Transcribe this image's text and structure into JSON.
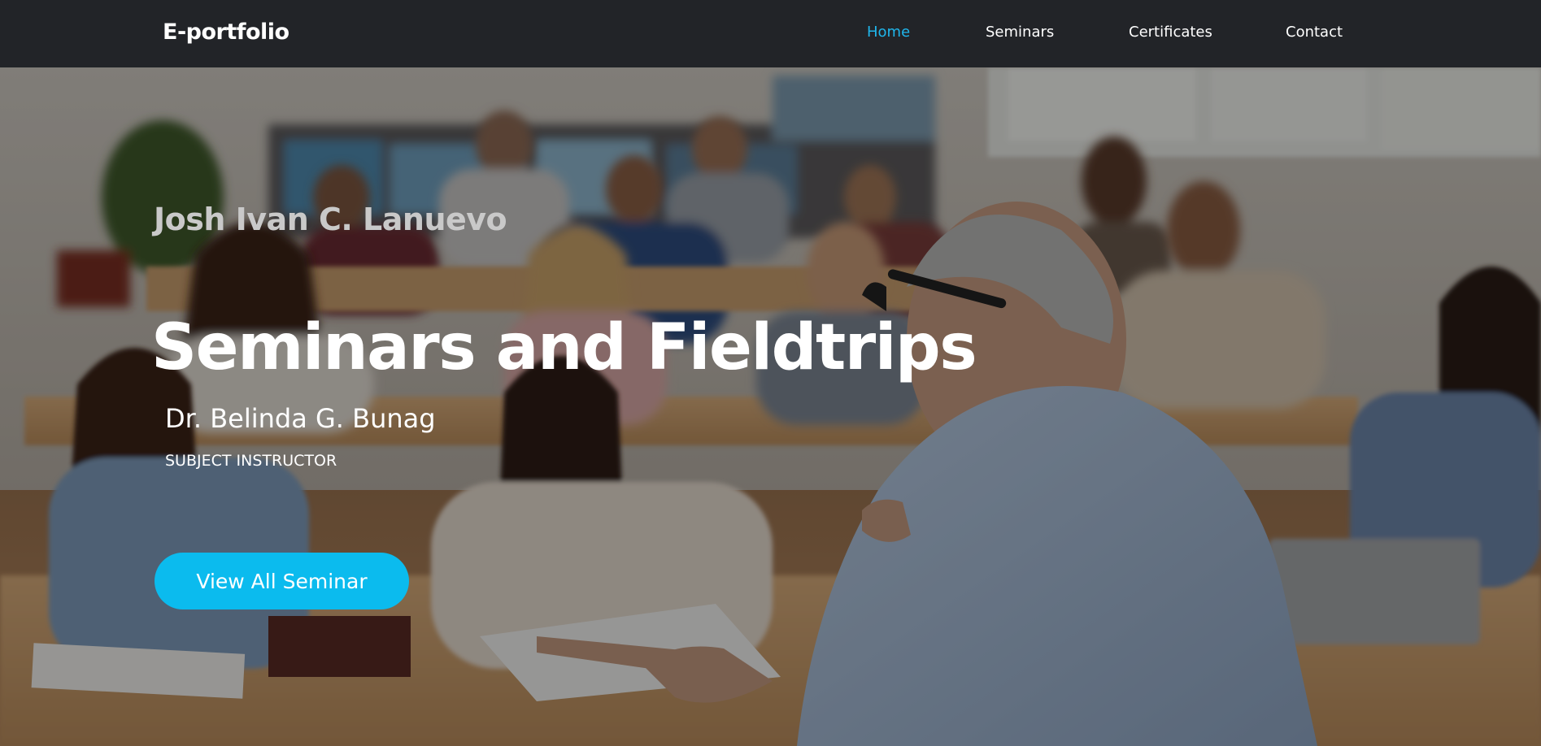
{
  "brand": "E-portfolio",
  "nav": {
    "items": [
      {
        "label": "Home",
        "active": true
      },
      {
        "label": "Seminars",
        "active": false
      },
      {
        "label": "Certificates",
        "active": false
      },
      {
        "label": "Contact",
        "active": false
      }
    ]
  },
  "hero": {
    "author": "Josh Ivan C. Lanuevo",
    "title": "Seminars and Fieldtrips",
    "instructor_name": "Dr. Belinda G. Bunag",
    "instructor_role": "SUBJECT INSTRUCTOR",
    "cta_label": "View All Seminar",
    "background_image": "classroom-lecture-photo"
  },
  "colors": {
    "navbar_bg": "#222428",
    "nav_active": "#1fb6ec",
    "cta_bg": "#0bbbee",
    "text": "#ffffff"
  }
}
